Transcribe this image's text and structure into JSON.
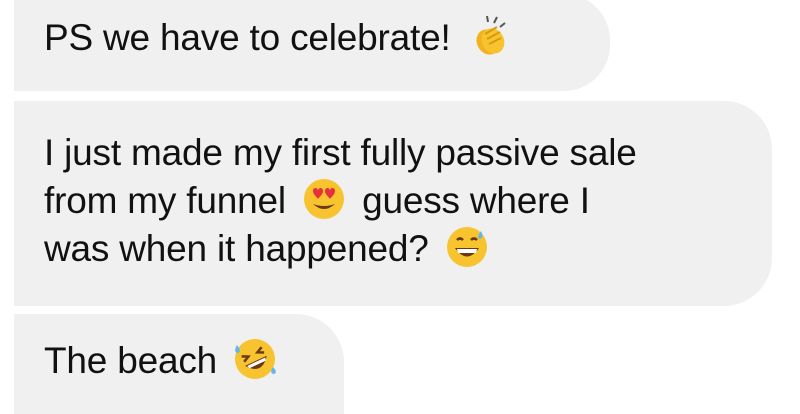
{
  "messages": [
    {
      "segments": [
        {
          "text": "PS we have to celebrate!"
        },
        {
          "emoji": "clapping-hands-emoji"
        }
      ]
    },
    {
      "lines": [
        [
          {
            "text": "I just made my first fully passive sale"
          }
        ],
        [
          {
            "text": "from my funnel"
          },
          {
            "emoji": "heart-eyes-emoji"
          },
          {
            "text": "guess where I"
          }
        ],
        [
          {
            "text": "was when it happened?"
          },
          {
            "emoji": "grinning-sweat-emoji"
          }
        ]
      ]
    },
    {
      "segments": [
        {
          "text": "The beach"
        },
        {
          "emoji": "rofl-emoji"
        }
      ]
    }
  ],
  "colors": {
    "bubble": "#f0f0f0",
    "text": "#111111",
    "emoji_face": "#f7c32e",
    "emoji_heart": "#e8303c"
  }
}
